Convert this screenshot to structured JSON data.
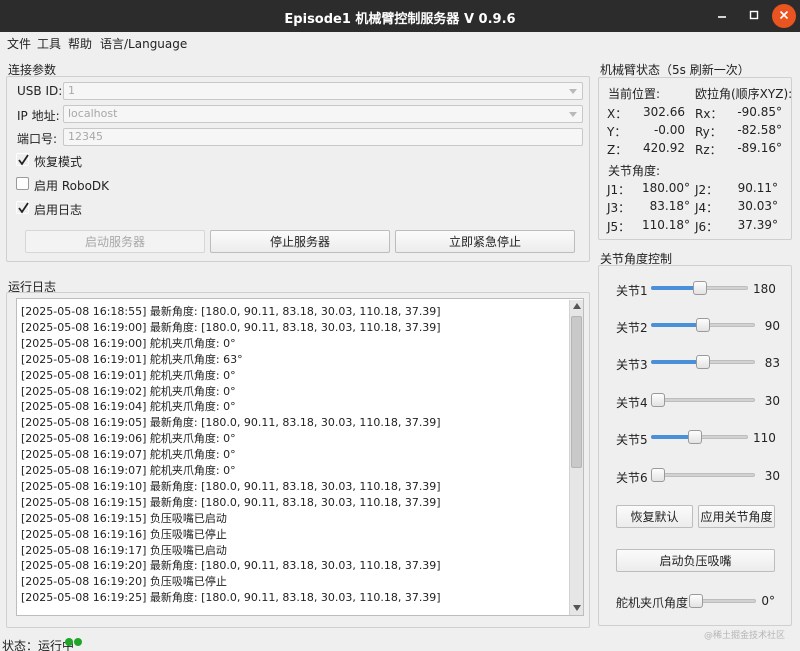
{
  "window": {
    "title": "Episode1 机械臂控制服务器 V 0.9.6"
  },
  "menu": [
    "文件",
    "工具",
    "帮助",
    "语言/Language"
  ],
  "connection": {
    "group_title": "连接参数",
    "usb_label": "USB ID:",
    "usb_value": "1",
    "ip_label": "IP 地址:",
    "ip_value": "localhost",
    "port_label": "端口号:",
    "port_placeholder": "12345",
    "recovery_label": "恢复模式",
    "recovery_checked": true,
    "robodk_label": "启用 RoboDK",
    "robodk_checked": false,
    "log_label": "启用日志",
    "log_checked": true,
    "start_button": "启动服务器",
    "stop_button": "停止服务器",
    "estop_button": "立即紧急停止"
  },
  "log": {
    "group_title": "运行日志",
    "lines": [
      "[2025-05-08 16:18:55] 最新角度: [180.0, 90.11, 83.18, 30.03, 110.18, 37.39]",
      "[2025-05-08 16:19:00] 最新角度: [180.0, 90.11, 83.18, 30.03, 110.18, 37.39]",
      "[2025-05-08 16:19:00] 舵机夹爪角度: 0°",
      "[2025-05-08 16:19:01] 舵机夹爪角度: 63°",
      "[2025-05-08 16:19:01] 舵机夹爪角度: 0°",
      "[2025-05-08 16:19:02] 舵机夹爪角度: 0°",
      "[2025-05-08 16:19:04] 舵机夹爪角度: 0°",
      "[2025-05-08 16:19:05] 最新角度: [180.0, 90.11, 83.18, 30.03, 110.18, 37.39]",
      "[2025-05-08 16:19:06] 舵机夹爪角度: 0°",
      "[2025-05-08 16:19:07] 舵机夹爪角度: 0°",
      "[2025-05-08 16:19:07] 舵机夹爪角度: 0°",
      "[2025-05-08 16:19:10] 最新角度: [180.0, 90.11, 83.18, 30.03, 110.18, 37.39]",
      "[2025-05-08 16:19:15] 最新角度: [180.0, 90.11, 83.18, 30.03, 110.18, 37.39]",
      "[2025-05-08 16:19:15] 负压吸嘴已启动",
      "[2025-05-08 16:19:16] 负压吸嘴已停止",
      "[2025-05-08 16:19:17] 负压吸嘴已启动",
      "[2025-05-08 16:19:20] 最新角度: [180.0, 90.11, 83.18, 30.03, 110.18, 37.39]",
      "[2025-05-08 16:19:20] 负压吸嘴已停止",
      "[2025-05-08 16:19:25] 最新角度: [180.0, 90.11, 83.18, 30.03, 110.18, 37.39]"
    ]
  },
  "arm_status": {
    "group_title": "机械臂状态（5s 刷新一次）",
    "position_label": "当前位置:",
    "euler_label": "欧拉角(顺序XYZ):",
    "x_label": "X：",
    "x_value": "302.66",
    "y_label": "Y：",
    "y_value": "-0.00",
    "z_label": "Z：",
    "z_value": "420.92",
    "rx_label": "Rx：",
    "rx_value": "-90.85°",
    "ry_label": "Ry：",
    "ry_value": "-82.58°",
    "rz_label": "Rz：",
    "rz_value": "-89.16°",
    "joint_label": "关节角度:",
    "j1_label": "J1：",
    "j1_value": "180.00°",
    "j2_label": "J2：",
    "j2_value": "90.11°",
    "j3_label": "J3：",
    "j3_value": "83.18°",
    "j4_label": "J4：",
    "j4_value": "30.03°",
    "j5_label": "J5：",
    "j5_value": "110.18°",
    "j6_label": "J6：",
    "j6_value": "37.39°"
  },
  "joint_control": {
    "group_title": "关节角度控制",
    "joints": [
      {
        "label": "关节1",
        "value": "180",
        "fraction": 0.5
      },
      {
        "label": "关节2",
        "value": "90",
        "fraction": 0.5
      },
      {
        "label": "关节3",
        "value": "83",
        "fraction": 0.5
      },
      {
        "label": "关节4",
        "value": "30",
        "fraction": 0.0
      },
      {
        "label": "关节5",
        "value": "110",
        "fraction": 0.45
      },
      {
        "label": "关节6",
        "value": "30",
        "fraction": 0.0
      }
    ],
    "reset_button": "恢复默认",
    "apply_button": "应用关节角度",
    "suction_button": "启动负压吸嘴",
    "gripper_label": "舵机夹爪角度:",
    "gripper_value": "0°",
    "gripper_fraction": 0.0
  },
  "status": {
    "text": "状态：运行中"
  },
  "watermark": "@稀土掘金技术社区",
  "colors": {
    "titlebar": "#2c2c2c",
    "close": "#e95420",
    "accent": "#4a90d9",
    "status_dot": "#1fa62a"
  }
}
